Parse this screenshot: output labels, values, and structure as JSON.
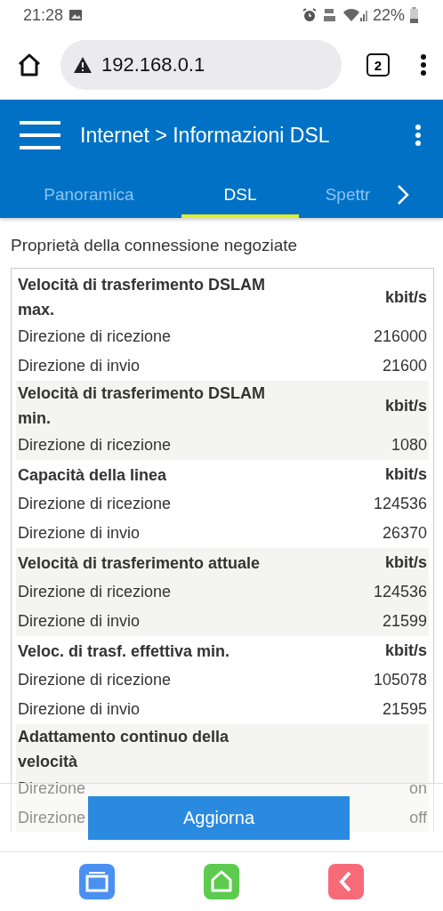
{
  "status_bar": {
    "time": "21:28",
    "battery": "22%"
  },
  "browser": {
    "url": "192.168.0.1",
    "tab_count": "2"
  },
  "header": {
    "title": "Internet > Informazioni DSL"
  },
  "tabs": [
    {
      "label": "Panoramica",
      "selected": false
    },
    {
      "label": "DSL",
      "selected": true
    },
    {
      "label": "Spettr",
      "selected": false
    }
  ],
  "section_title": "Proprietà della connessione negoziate",
  "table": {
    "groups": [
      {
        "title": "Velocità di trasferimento DSLAM max.",
        "unit": "kbit/s",
        "rows": [
          {
            "label": "Direzione di ricezione",
            "value": "216000"
          },
          {
            "label": "Direzione di invio",
            "value": "21600"
          }
        ]
      },
      {
        "title": "Velocità di trasferimento DSLAM min.",
        "unit": "kbit/s",
        "rows": [
          {
            "label": "Direzione di ricezione",
            "value": "1080"
          }
        ]
      },
      {
        "title": "Capacità della linea",
        "unit": "kbit/s",
        "rows": [
          {
            "label": "Direzione di ricezione",
            "value": "124536"
          },
          {
            "label": "Direzione di invio",
            "value": "26370"
          }
        ]
      },
      {
        "title": "Velocità di trasferimento attuale",
        "unit": "kbit/s",
        "rows": [
          {
            "label": "Direzione di ricezione",
            "value": "124536"
          },
          {
            "label": "Direzione di invio",
            "value": "21599"
          }
        ]
      },
      {
        "title": "Veloc. di trasf. effettiva min.",
        "unit": "kbit/s",
        "rows": [
          {
            "label": "Direzione di ricezione",
            "value": "105078"
          },
          {
            "label": "Direzione di invio",
            "value": "21595"
          }
        ]
      },
      {
        "title": "Adattamento continuo della velocità",
        "rows": [
          {
            "label": "Direzione",
            "value": "on"
          },
          {
            "label": "Direzione",
            "value": "off"
          }
        ]
      }
    ]
  },
  "button": "Aggiorna"
}
